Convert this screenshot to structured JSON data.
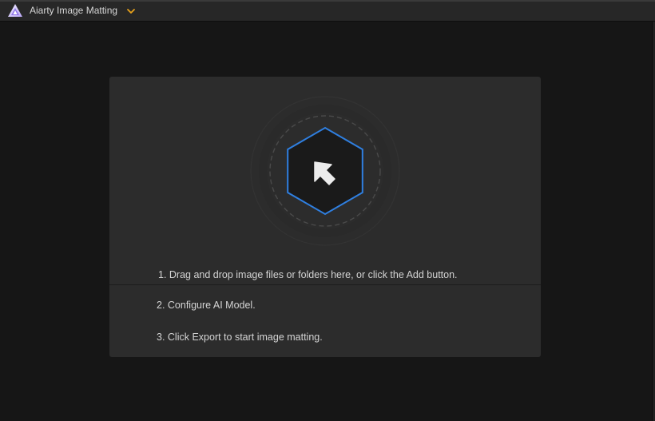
{
  "window": {
    "title": "Aiarty Image Matting"
  },
  "icons": {
    "app_logo": "aiarty-logo-icon",
    "title_menu": "chevron-down-icon",
    "add_files": "arrow-up-left-icon"
  },
  "colors": {
    "accent_blue": "#2f7fe0",
    "menu_chevron": "#e8a21b",
    "background": "#161616",
    "panel": "#2c2c2c"
  },
  "instructions": {
    "step1": "1. Drag and drop image files or folders here, or click the Add button.",
    "step2": "2. Configure AI Model.",
    "step3": "3. Click Export to start image matting."
  }
}
